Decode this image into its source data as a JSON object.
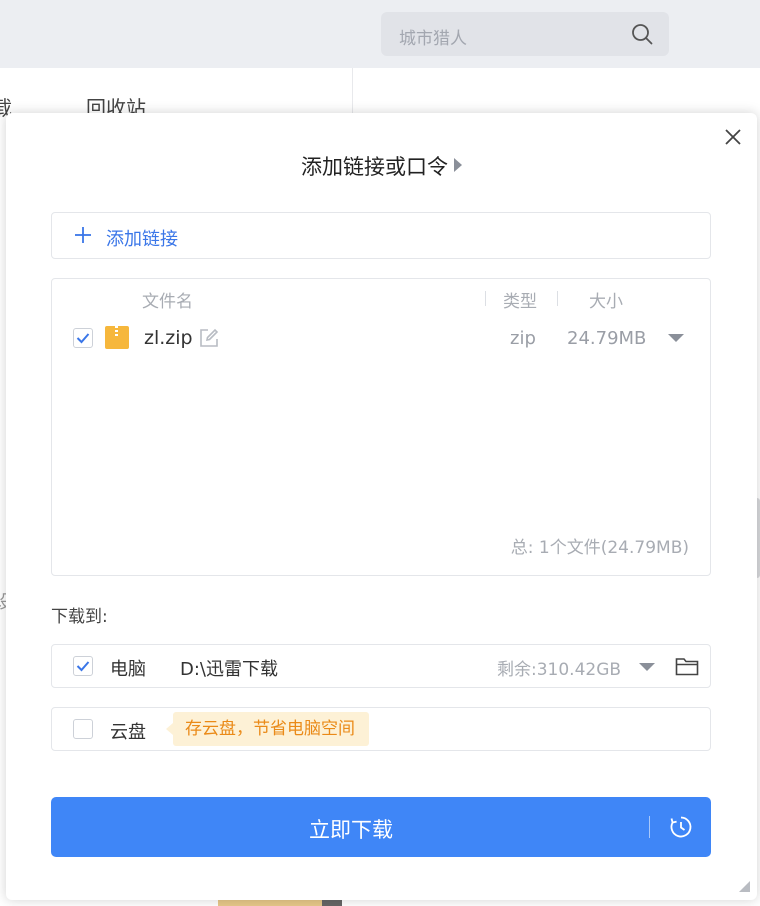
{
  "background": {
    "search_placeholder": "城市猎人",
    "tab_partial": "载",
    "tab_recycle": "回收站",
    "side_partial": "设"
  },
  "dialog": {
    "title": "添加链接或口令",
    "add_link_label": "添加链接",
    "columns": {
      "name": "文件名",
      "type": "类型",
      "size": "大小"
    },
    "files": [
      {
        "name": "zl.zip",
        "type": "zip",
        "size": "24.79MB",
        "checked": true
      }
    ],
    "total": "总:  1个文件(24.79MB)",
    "download_to_label": "下载到:",
    "destinations": {
      "computer": {
        "label": "电脑",
        "path": "D:\\迅雷下载",
        "free": "剩余:310.42GB",
        "checked": true
      },
      "cloud": {
        "label": "云盘",
        "tip": "存云盘，节省电脑空间",
        "checked": false
      }
    },
    "download_button": "立即下载"
  },
  "colors": {
    "accent": "#3f86f7",
    "link": "#3a76e8",
    "tip_text": "#ea8a18",
    "tip_bg": "#fdf1d6",
    "zip": "#f6b73c"
  }
}
